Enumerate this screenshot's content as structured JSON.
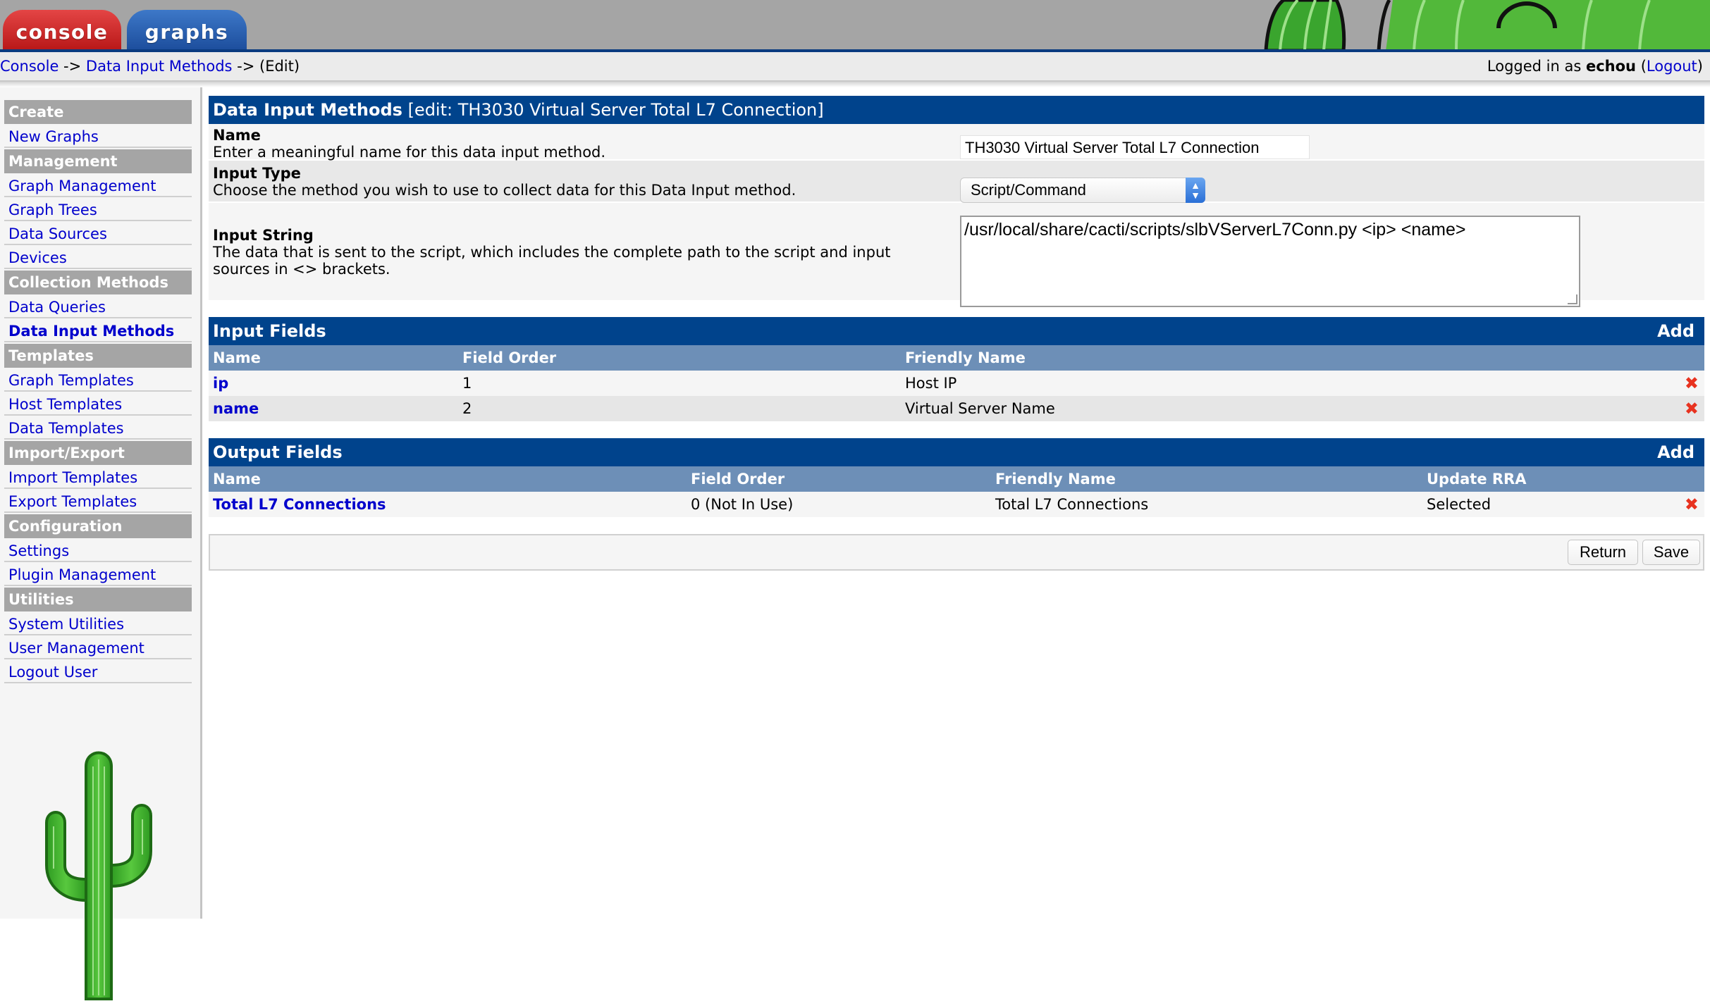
{
  "header": {
    "tabs": [
      {
        "label": "console"
      },
      {
        "label": "graphs"
      }
    ]
  },
  "breadcrumb": {
    "items": [
      "Console",
      "Data Input Methods"
    ],
    "separator": " -> ",
    "current": "(Edit)"
  },
  "login": {
    "prefix": "Logged in as ",
    "user": "echou",
    "open": " (",
    "logout": "Logout",
    "close": ")"
  },
  "sidebar": {
    "sections": [
      {
        "title": "Create",
        "items": [
          "New Graphs"
        ]
      },
      {
        "title": "Management",
        "items": [
          "Graph Management",
          "Graph Trees",
          "Data Sources",
          "Devices"
        ]
      },
      {
        "title": "Collection Methods",
        "items": [
          "Data Queries",
          "Data Input Methods"
        ]
      },
      {
        "title": "Templates",
        "items": [
          "Graph Templates",
          "Host Templates",
          "Data Templates"
        ]
      },
      {
        "title": "Import/Export",
        "items": [
          "Import Templates",
          "Export Templates"
        ]
      },
      {
        "title": "Configuration",
        "items": [
          "Settings",
          "Plugin Management"
        ]
      },
      {
        "title": "Utilities",
        "items": [
          "System Utilities",
          "User Management",
          "Logout User"
        ]
      }
    ],
    "active_item": "Data Input Methods"
  },
  "form": {
    "title": "Data Input Methods",
    "subtitle": "[edit: TH3030 Virtual Server Total L7 Connection]",
    "name_label": "Name",
    "name_desc": "Enter a meaningful name for this data input method.",
    "name_value": "TH3030 Virtual Server Total L7 Connection",
    "type_label": "Input Type",
    "type_desc": "Choose the method you wish to use to collect data for this Data Input method.",
    "type_value": "Script/Command",
    "string_label": "Input String",
    "string_desc": "The data that is sent to the script, which includes the complete path to the script and input sources in <> brackets.",
    "string_value": "/usr/local/share/cacti/scripts/slbVServerL7Conn.py <ip> <name>"
  },
  "input_fields": {
    "title": "Input Fields",
    "add_label": "Add",
    "columns": [
      "Name",
      "Field Order",
      "Friendly Name"
    ],
    "rows": [
      {
        "name": "ip",
        "order": "1",
        "friendly": "Host IP"
      },
      {
        "name": "name",
        "order": "2",
        "friendly": "Virtual Server Name"
      }
    ]
  },
  "output_fields": {
    "title": "Output Fields",
    "add_label": "Add",
    "columns": [
      "Name",
      "Field Order",
      "Friendly Name",
      "Update RRA"
    ],
    "rows": [
      {
        "name": "Total L7 Connections",
        "order": "0 (Not In Use)",
        "friendly": "Total L7 Connections",
        "rra": "Selected"
      }
    ]
  },
  "buttons": {
    "return_label": "Return",
    "save_label": "Save"
  },
  "icons": {
    "delete": "delete-x-icon",
    "select_arrows": "select-updown-icon",
    "logo": "cactus-logo"
  },
  "colors": {
    "panel_header": "#00438c",
    "grid_header": "#6d8fb7",
    "sidebar_header": "#a5a5a5",
    "link": "#0000cc",
    "delete": "#e8321f"
  }
}
